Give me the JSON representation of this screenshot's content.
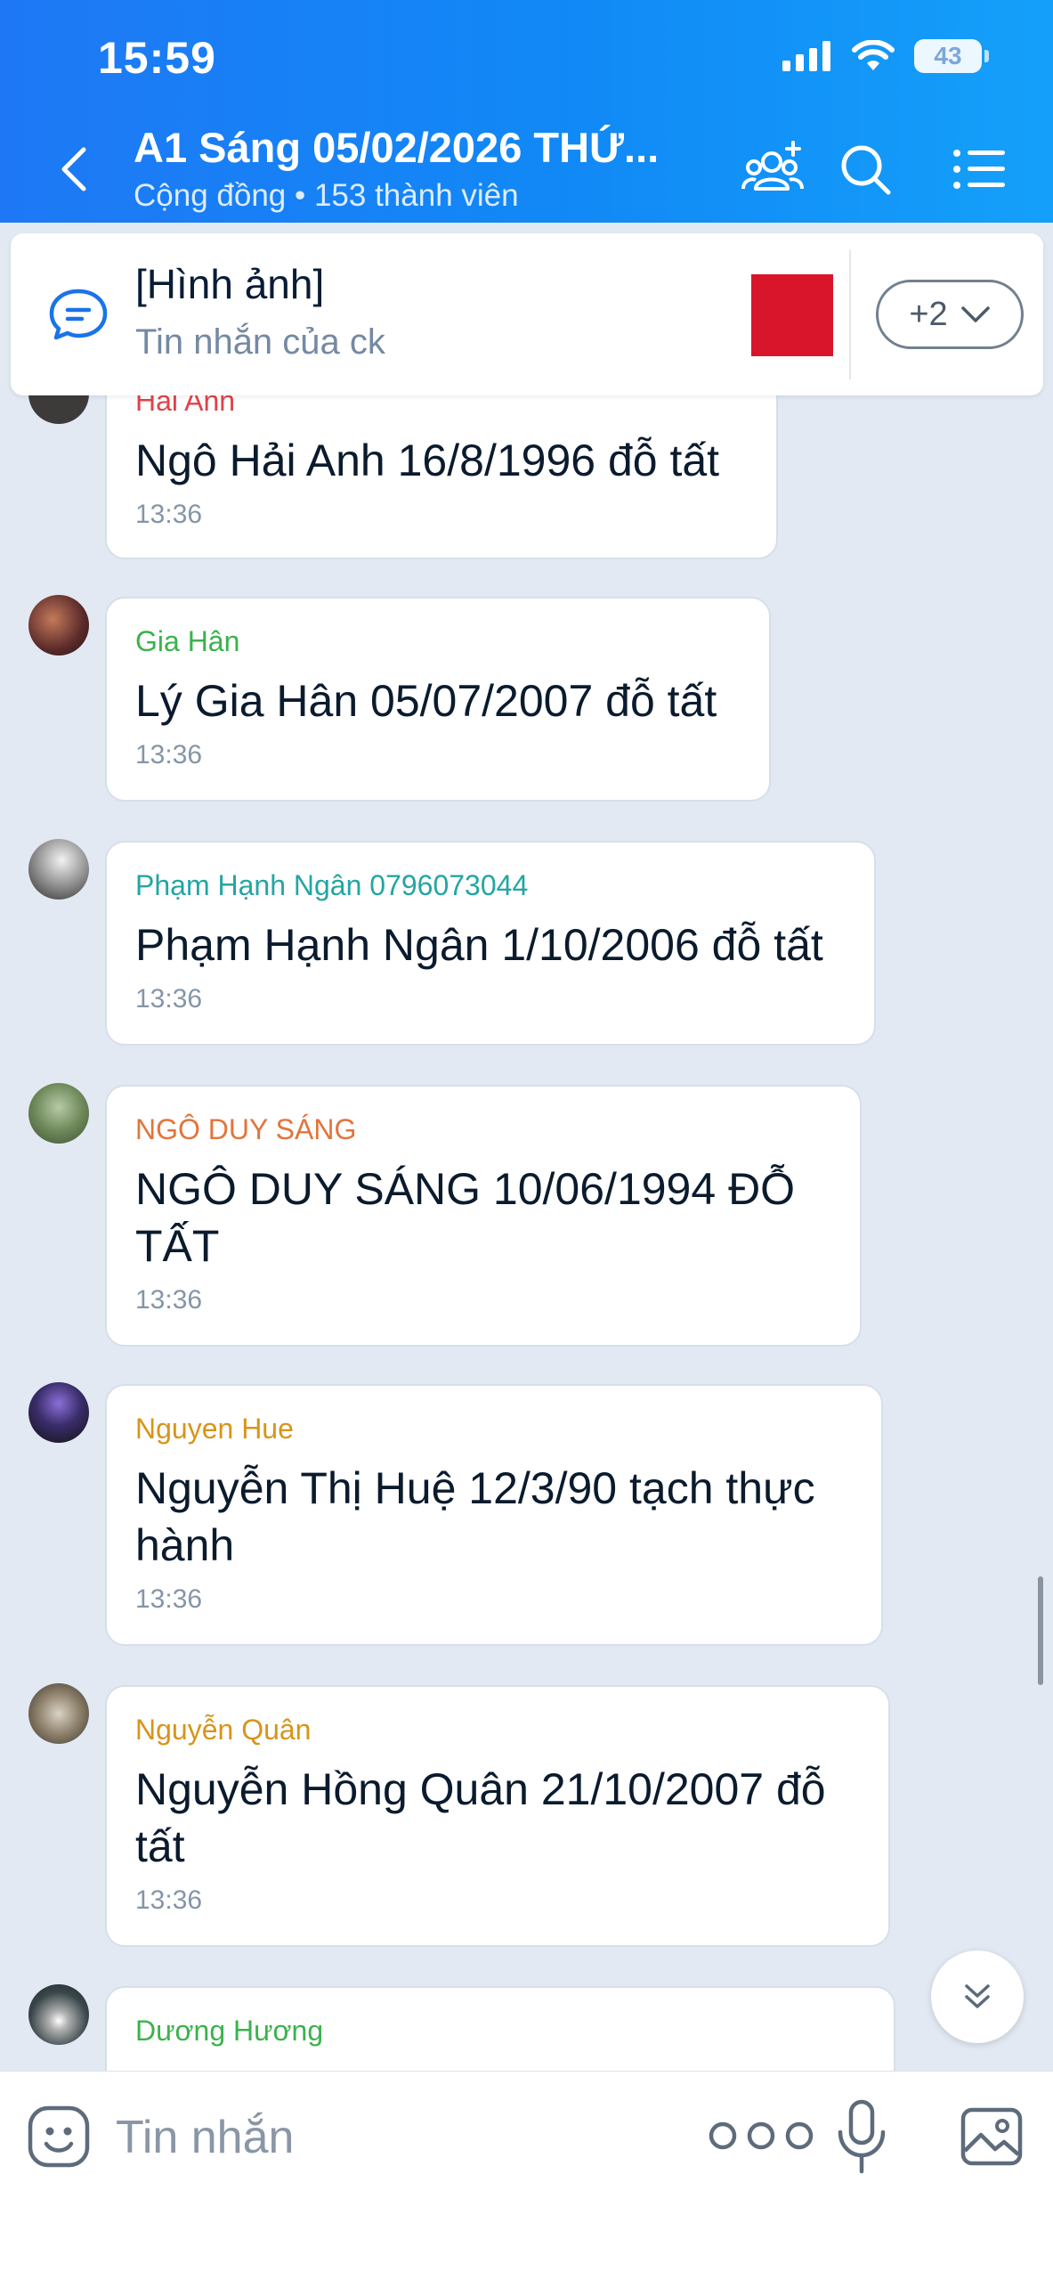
{
  "status_bar": {
    "time": "15:59",
    "battery": "43"
  },
  "header": {
    "title": "A1 Sáng 05/02/2026 THỨ...",
    "subtitle": "Cộng đồng • 153 thành viên",
    "icons": [
      "back-icon",
      "group-add-icon",
      "search-icon",
      "menu-list-icon"
    ]
  },
  "pinned": {
    "title": "[Hình ảnh]",
    "subtitle": "Tin nhắn của ck",
    "more_count": "+2"
  },
  "messages": [
    {
      "sender": "Hải Anh",
      "sender_color": "#e0424a",
      "text": "Ngô Hải Anh 16/8/1996 đỗ tất",
      "time": "13:36"
    },
    {
      "sender": "Gia Hân",
      "sender_color": "#3bb24c",
      "text": "Lý Gia Hân 05/07/2007 đỗ tất",
      "time": "13:36"
    },
    {
      "sender": "Phạm Hạnh Ngân 0796073044",
      "sender_color": "#23a6a3",
      "text": "Phạm Hạnh Ngân 1/10/2006 đỗ tất",
      "time": "13:36"
    },
    {
      "sender": "NGÔ DUY SÁNG",
      "sender_color": "#e3743a",
      "text": "NGÔ DUY SÁNG 10/06/1994  ĐỖ TẤT",
      "time": "13:36"
    },
    {
      "sender": "Nguyen Hue",
      "sender_color": "#d99418",
      "text": "Nguyễn Thị Huệ 12/3/90 tạch thực hành",
      "time": "13:36"
    },
    {
      "sender": "Nguyễn Quân",
      "sender_color": "#d99418",
      "text": "Nguyễn Hồng Quân 21/10/2007 đỗ tất",
      "time": "13:36"
    },
    {
      "sender": "Dương Hương",
      "sender_color": "#3bb24c",
      "text": "",
      "time": ""
    }
  ],
  "input": {
    "placeholder": "Tin nhắn"
  },
  "colors": {
    "header_start": "#1e78f5",
    "header_end": "#14a0fa",
    "accent": "#0068ff",
    "chat_bg": "#e2e9f3"
  }
}
